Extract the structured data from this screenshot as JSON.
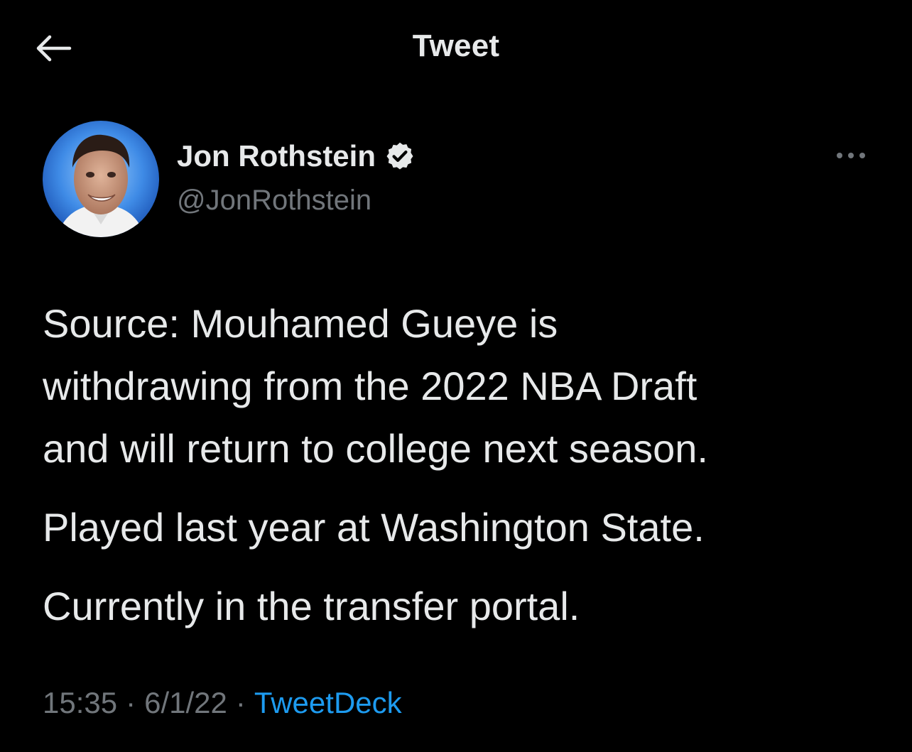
{
  "header": {
    "title": "Tweet",
    "back_icon": "arrow-left-icon"
  },
  "author": {
    "name": "Jon Rothstein",
    "handle": "@JonRothstein",
    "verified_icon": "verified-badge-icon",
    "more_icon": "more-dots-icon"
  },
  "tweet": {
    "paragraphs": [
      "Source: Mouhamed Gueye is\nwithdrawing from the 2022 NBA Draft\nand will return to college next season.",
      "Played last year at Washington State.",
      "Currently in the transfer portal."
    ],
    "time": "15:35",
    "date": "6/1/22",
    "separator": "·",
    "source": "TweetDeck"
  },
  "colors": {
    "background": "#000000",
    "text_primary": "#e7e9ea",
    "text_secondary": "#71767b",
    "accent": "#1d9bf0"
  }
}
